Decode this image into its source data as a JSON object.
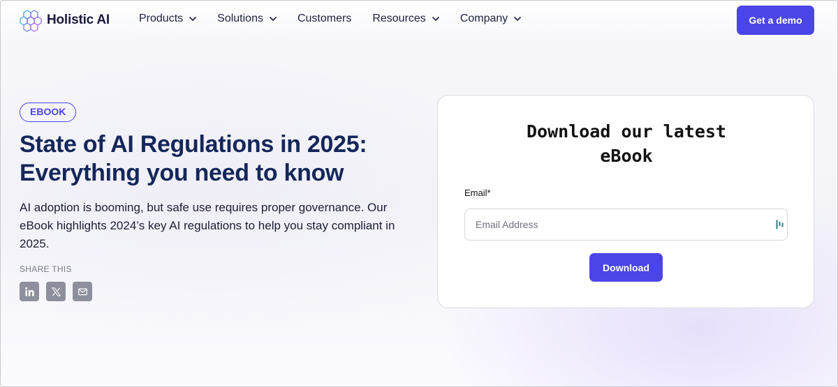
{
  "nav": {
    "logo_text": "Holistic AI",
    "items": [
      {
        "label": "Products",
        "dropdown": true
      },
      {
        "label": "Solutions",
        "dropdown": true
      },
      {
        "label": "Customers",
        "dropdown": false
      },
      {
        "label": "Resources",
        "dropdown": true
      },
      {
        "label": "Company",
        "dropdown": true
      }
    ],
    "cta_label": "Get a demo"
  },
  "hero": {
    "badge": "EBOOK",
    "title_line1": "State of AI Regulations in 2025:",
    "title_line2": "Everything you need to know",
    "description": "AI adoption is booming, but safe use requires proper governance. Our eBook highlights 2024’s key AI regulations to help you stay compliant in 2025.",
    "share_label": "SHARE THIS",
    "share_icons": [
      "linkedin-icon",
      "x-icon",
      "mail-icon"
    ]
  },
  "form": {
    "title_line1": "Download our latest",
    "title_line2": "eBook",
    "email_label": "Email*",
    "email_value": "",
    "email_placeholder": "Email Address",
    "submit_label": "Download"
  },
  "colors": {
    "accent": "#4b45e8",
    "heading": "#14275a",
    "share_icon_bg": "#8d909c"
  }
}
